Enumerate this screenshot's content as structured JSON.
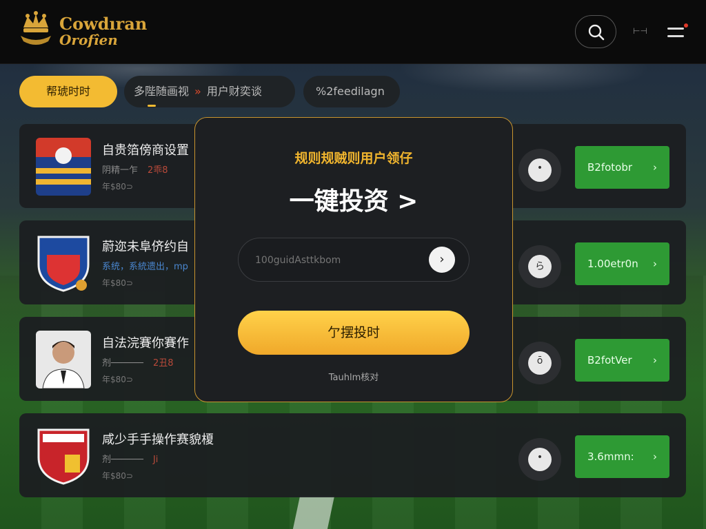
{
  "brand": {
    "line1": "Cowdıran",
    "line2": "Orofîen"
  },
  "header": {
    "mini_icon": "⊢⊣"
  },
  "filters": {
    "active": "帮琥时时",
    "nav_left": "多陛随画视",
    "nav_sep": "»",
    "nav_right": "用户财奕谈",
    "select": "%2feedilagn",
    "select_chevron": "⌄"
  },
  "matches": [
    {
      "title": "自贵箔傍商设置",
      "sub": "阴精一乍",
      "sub_hl": "2乖8",
      "meta": "年$80⊃",
      "status": "•",
      "odds": "B2fotobr",
      "chevron": "›",
      "badge": "crest-1"
    },
    {
      "title": "蔚迩未阜侪约自",
      "sub": "系统，系統遗出，mp",
      "sub_hl": "",
      "meta": "年$80⊃",
      "status": "ら",
      "odds": "1.00etr0n",
      "chevron": "›",
      "badge": "crest-2"
    },
    {
      "title": "自法浣賽你賽作",
      "sub": "剂──────",
      "sub_hl": "2丑8",
      "meta": "年$80⊃",
      "status": "ō",
      "odds": "B2fotVer",
      "chevron": "›",
      "badge": "player"
    },
    {
      "title": "咸少手手操作赛貌榎",
      "sub": "剂──────",
      "sub_hl": "Ji",
      "meta": "年$80⊃",
      "status": "•",
      "odds": "3.6mmn:",
      "chevron": "›",
      "badge": "crest-3"
    }
  ],
  "modal": {
    "subtitle": "规则规贼则用户领仔",
    "title": "一键投资 >",
    "input_placeholder": "100guidAsttkbom",
    "go_glyph": "›",
    "button": "亇摆投时",
    "footer": "Tauhlm核对"
  },
  "colors": {
    "accent": "#f3bb32",
    "odds_green": "#2e9a34",
    "modal_border": "#c9952e"
  }
}
